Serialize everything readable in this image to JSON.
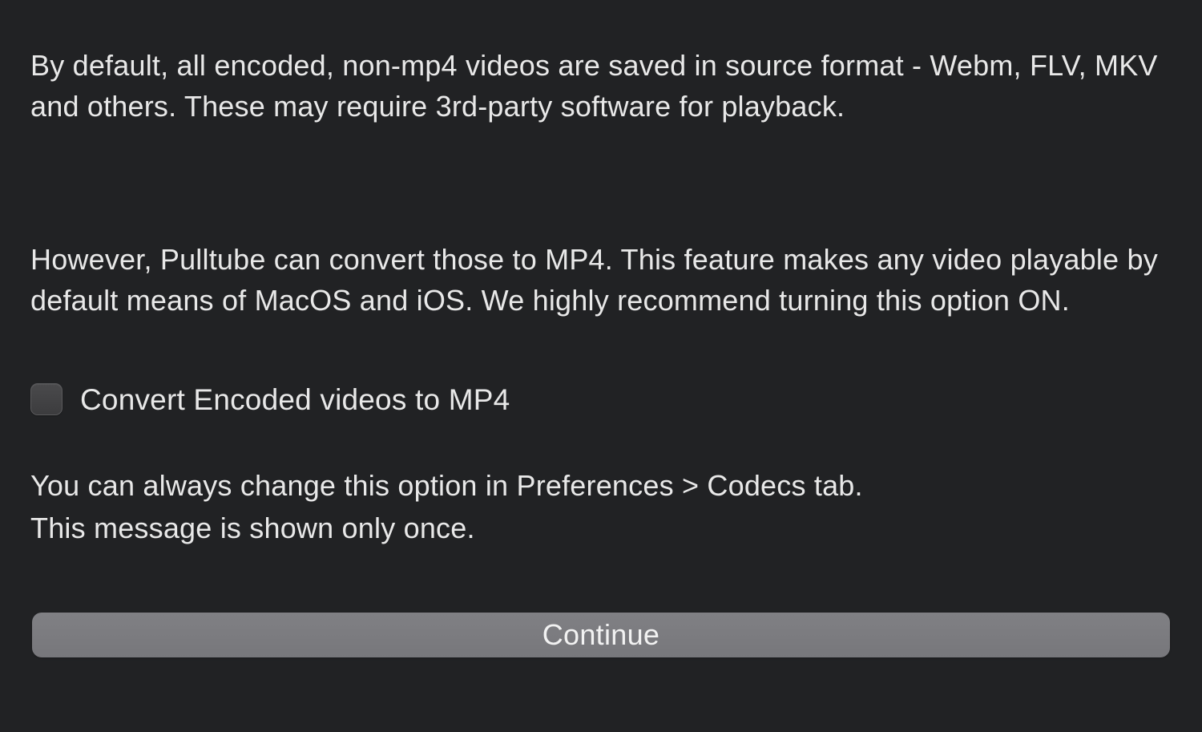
{
  "dialog": {
    "paragraph1": "By default, all encoded, non-mp4 videos are saved in source format - Webm, FLV, MKV and others. These may require 3rd-party software for playback.",
    "paragraph2": "However, Pulltube can convert those to MP4. This feature makes any video playable by default means of MacOS and iOS. We highly recommend turning this option ON.",
    "checkbox": {
      "label": "Convert Encoded videos to MP4",
      "checked": false
    },
    "note_line1": "You can always change this option in Preferences > Codecs tab.",
    "note_line2": "This message is shown only once.",
    "continue_label": "Continue"
  }
}
